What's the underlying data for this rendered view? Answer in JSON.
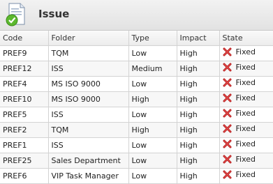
{
  "header": {
    "title": "Issue",
    "icon": "document-check-icon"
  },
  "columns": [
    "Code",
    "Folder",
    "Type",
    "Impact",
    "State"
  ],
  "rows": [
    {
      "code": "PREF9",
      "folder": "TQM",
      "type": "Low",
      "impact": "High",
      "state": "Fixed"
    },
    {
      "code": "PREF12",
      "folder": "ISS",
      "type": "Medium",
      "impact": "High",
      "state": "Fixed"
    },
    {
      "code": "PREF4",
      "folder": "MS ISO 9000",
      "type": "Low",
      "impact": "High",
      "state": "Fixed"
    },
    {
      "code": "PREF10",
      "folder": "MS ISO 9000",
      "type": "High",
      "impact": "High",
      "state": "Fixed"
    },
    {
      "code": "PREF5",
      "folder": "ISS",
      "type": "Low",
      "impact": "High",
      "state": "Fixed"
    },
    {
      "code": "PREF2",
      "folder": "TQM",
      "type": "High",
      "impact": "High",
      "state": "Fixed"
    },
    {
      "code": "PREF1",
      "folder": "ISS",
      "type": "Low",
      "impact": "High",
      "state": "Fixed"
    },
    {
      "code": "PREF25",
      "folder": "Sales Department",
      "type": "Low",
      "impact": "High",
      "state": "Fixed"
    },
    {
      "code": "PREF6",
      "folder": "VIP Task Manager",
      "type": "Low",
      "impact": "High",
      "state": "Fixed"
    }
  ],
  "state_icon": "red-x-icon"
}
